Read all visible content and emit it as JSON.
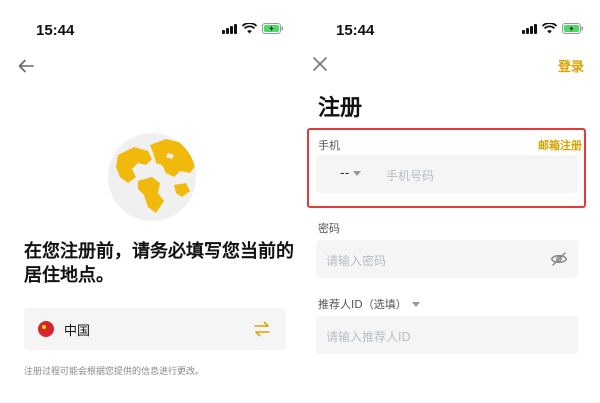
{
  "left": {
    "status": {
      "time": "15:44"
    },
    "headline": "在您注册前，请务必填写您当前的居住地点。",
    "country": {
      "name": "中国"
    },
    "footnote": "注册过程可能会根据您提供的信息进行更改。",
    "icons": {
      "back": "arrow-left-icon",
      "globe": "globe-illustration",
      "flag": "china-flag-icon",
      "swap": "swap-arrows-icon"
    }
  },
  "right": {
    "status": {
      "time": "15:44"
    },
    "login_link": "登录",
    "title": "注册",
    "phone": {
      "label": "手机",
      "switch_label": "邮箱注册",
      "prefix": "--",
      "placeholder": "手机号码"
    },
    "password": {
      "label": "密码",
      "placeholder": "请输入密码"
    },
    "referrer": {
      "label": "推荐人ID（选填）",
      "placeholder": "请输入推荐人ID"
    },
    "icons": {
      "close": "close-icon",
      "eye": "eye-off-icon"
    }
  },
  "colors": {
    "accent": "#d9a300",
    "highlight": "#e23b3b",
    "field_bg": "#f5f5f5",
    "placeholder": "#b7bdc6",
    "globe": "#f0b90b"
  }
}
